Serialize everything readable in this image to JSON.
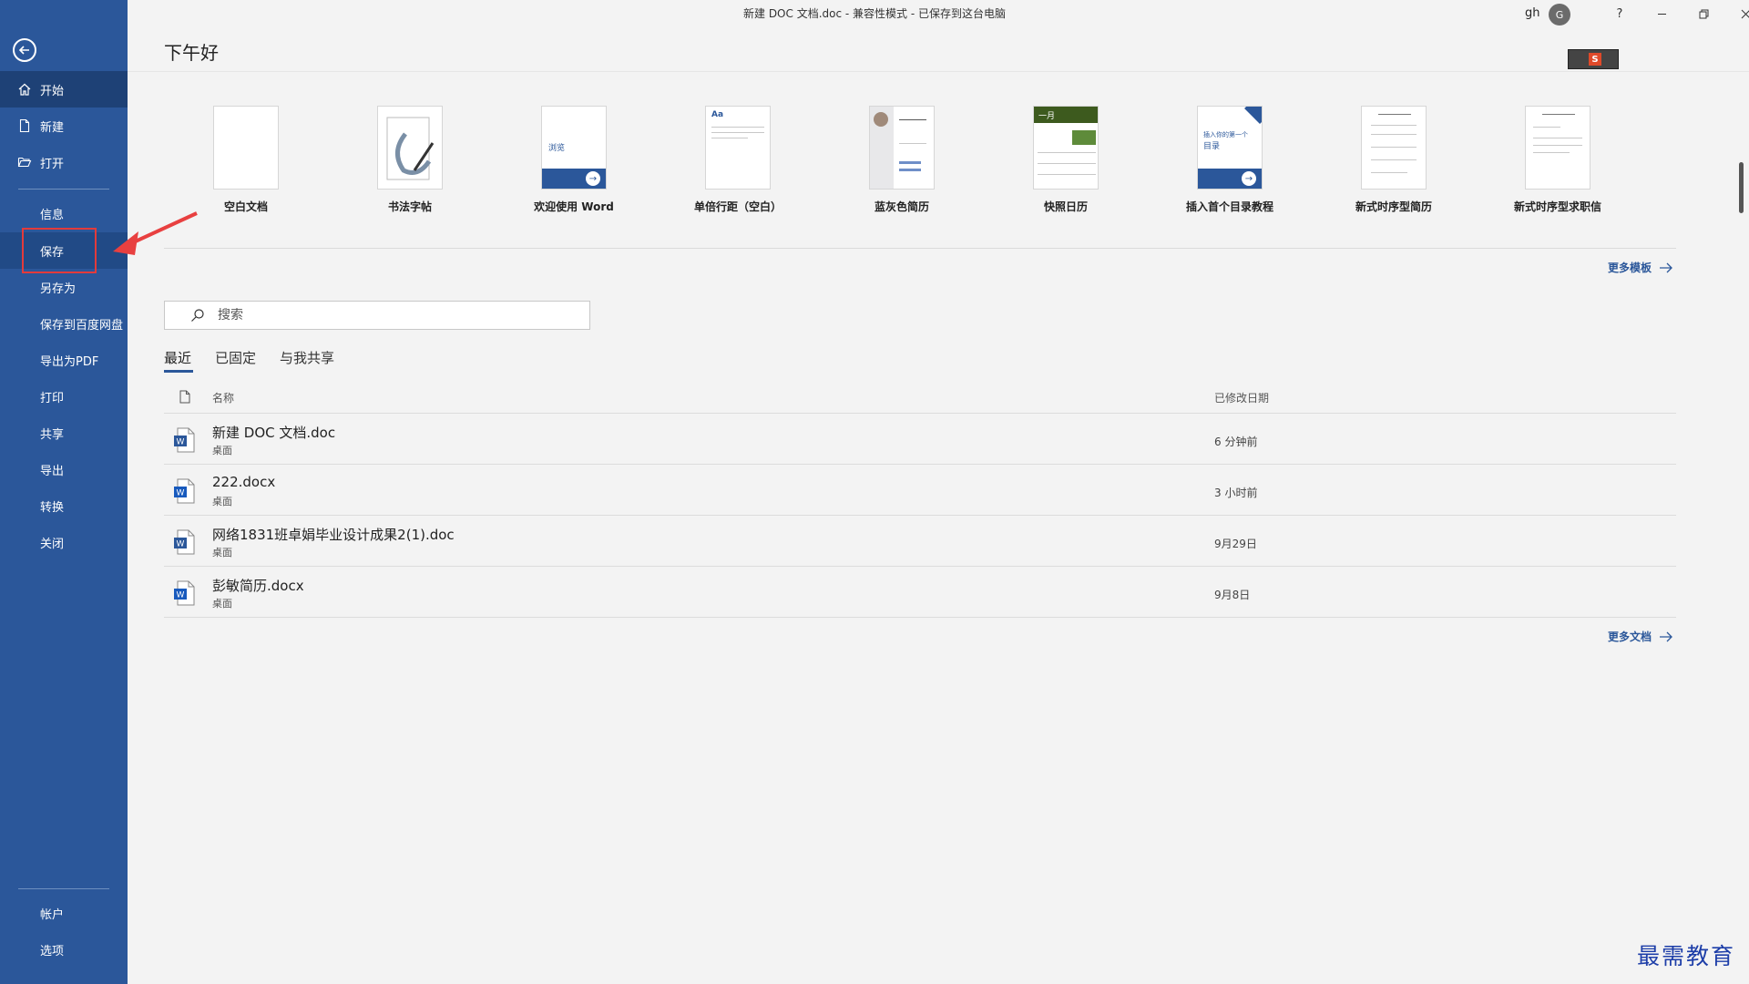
{
  "window": {
    "title": "新建 DOC 文档.doc  -  兼容性模式  -  已保存到这台电脑",
    "user_name": "gh",
    "avatar_initial": "G",
    "help": "?"
  },
  "greeting": "下午好",
  "sidebar": {
    "items": [
      {
        "label": "开始",
        "icon": "home-icon"
      },
      {
        "label": "新建",
        "icon": "new-document-icon"
      },
      {
        "label": "打开",
        "icon": "folder-open-icon"
      },
      {
        "label": "信息"
      },
      {
        "label": "保存"
      },
      {
        "label": "另存为"
      },
      {
        "label": "保存到百度网盘"
      },
      {
        "label": "导出为PDF"
      },
      {
        "label": "打印"
      },
      {
        "label": "共享"
      },
      {
        "label": "导出"
      },
      {
        "label": "转换"
      },
      {
        "label": "关闭"
      }
    ],
    "bottom": [
      {
        "label": "帐户"
      },
      {
        "label": "选项"
      }
    ]
  },
  "templates": [
    {
      "label": "空白文档"
    },
    {
      "label": "书法字帖"
    },
    {
      "label": "欢迎使用 Word",
      "thumb_text": "浏览"
    },
    {
      "label": "单倍行距（空白）",
      "thumb_text": "Aa"
    },
    {
      "label": "蓝灰色简历"
    },
    {
      "label": "快照日历",
      "thumb_text": "一月"
    },
    {
      "label": "插入首个目录教程",
      "thumb_text": "插入你的第一个",
      "thumb_text2": "目录"
    },
    {
      "label": "新式时序型简历"
    },
    {
      "label": "新式时序型求职信"
    }
  ],
  "more_templates": "更多模板",
  "search": {
    "placeholder": "搜索"
  },
  "tabs": [
    {
      "label": "最近"
    },
    {
      "label": "已固定"
    },
    {
      "label": "与我共享"
    }
  ],
  "columns": {
    "name": "名称",
    "modified": "已修改日期"
  },
  "files": [
    {
      "name": "新建 DOC 文档.doc",
      "location": "桌面",
      "modified": "6 分钟前",
      "type": "doc"
    },
    {
      "name": "222.docx",
      "location": "桌面",
      "modified": "3 小时前",
      "type": "docx"
    },
    {
      "name": "网络1831班卓娟毕业设计成果2(1).doc",
      "location": "桌面",
      "modified": "9月29日",
      "type": "doc"
    },
    {
      "name": "彭敏简历.docx",
      "location": "桌面",
      "modified": "9月8日",
      "type": "docx"
    }
  ],
  "more_docs": "更多文档",
  "watermark": "最需教育",
  "colors": {
    "sidebar": "#2b579a",
    "accent": "#2b579a",
    "highlight": "#e33b3b"
  }
}
